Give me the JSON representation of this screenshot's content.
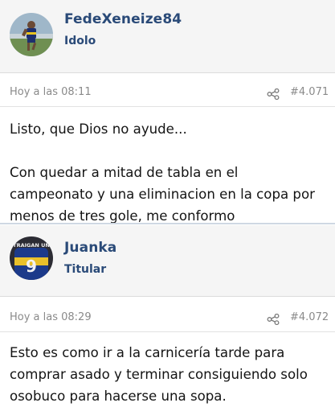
{
  "posts": [
    {
      "username": "FedeXeneize84",
      "user_title": "Idolo",
      "timestamp": "Hoy a las 08:11",
      "post_number": "#4.071",
      "message_lines_1": [
        "Listo, que Dios no ayude..."
      ],
      "message_lines_2": [
        "Con quedar a mitad de tabla en el",
        "campeonato y una eliminacion en la copa por",
        "menos de tres gole, me conformo"
      ]
    },
    {
      "username": "Juanka",
      "user_title": "Titular",
      "timestamp": "Hoy a las 08:29",
      "post_number": "#4.072",
      "avatar_text": "TRAIGAN UN",
      "jersey_number": "9",
      "message_lines_1": [
        "Esto es como ir a la carnicería tarde para",
        "comprar asado y terminar consiguiendo solo",
        "osobuco para hacerse una sopa."
      ]
    }
  ],
  "icons": {
    "share": "share-icon"
  },
  "colors": {
    "username": "#2a4a78",
    "meta_text": "#8a8a8a",
    "header_bg": "#f5f5f5",
    "divider": "#cfd8e3"
  }
}
